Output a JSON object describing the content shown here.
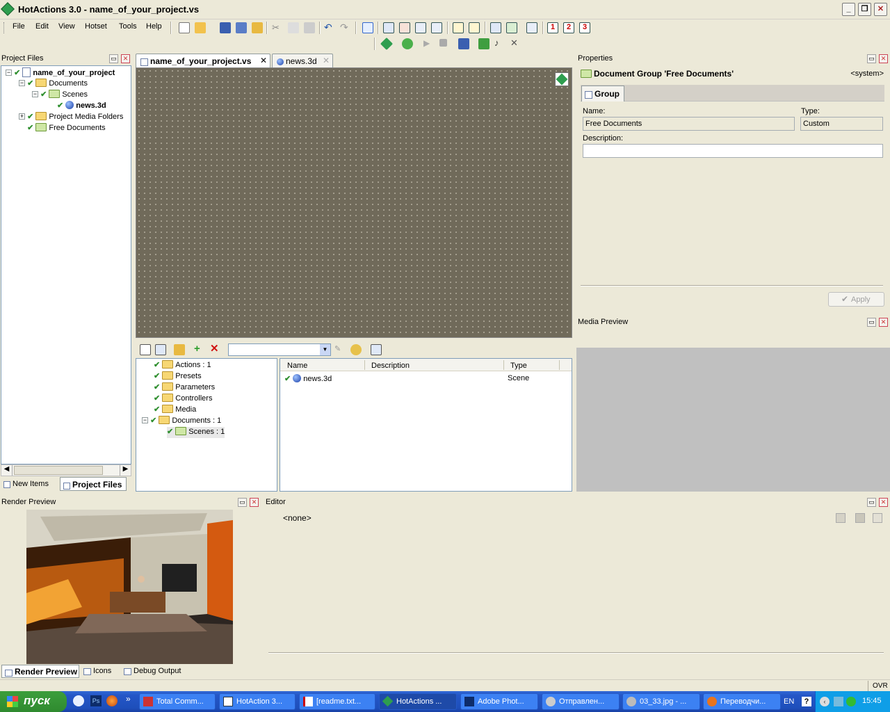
{
  "window": {
    "title": "HotActions 3.0 - name_of_your_project.vs"
  },
  "menu": [
    "File",
    "Edit",
    "View",
    "Hotset",
    "Tools",
    "Help"
  ],
  "project_files": {
    "title": "Project Files",
    "tree": [
      {
        "label": "name_of_your_project",
        "bold": true
      },
      {
        "label": "Documents"
      },
      {
        "label": "Scenes"
      },
      {
        "label": "news.3d",
        "bold": true
      },
      {
        "label": "Project Media Folders"
      },
      {
        "label": "Free Documents"
      }
    ],
    "bottom_tabs": [
      "New Items",
      "Project Files"
    ]
  },
  "doc_tabs": [
    "name_of_your_project.vs",
    "news.3d"
  ],
  "lower_tree": [
    "Actions : 1",
    "Presets",
    "Parameters",
    "Controllers",
    "Media",
    "Documents : 1",
    "Scenes : 1"
  ],
  "list": {
    "columns": [
      "Name",
      "Description",
      "Type"
    ],
    "rows": [
      {
        "name": "news.3d",
        "description": "",
        "type": "Scene"
      }
    ]
  },
  "properties": {
    "title": "Properties",
    "group_header": "Document Group 'Free Documents'",
    "system": "<system>",
    "tab": "Group",
    "name_label": "Name:",
    "name_value": "Free Documents",
    "type_label": "Type:",
    "type_value": "Custom",
    "desc_label": "Description:",
    "desc_value": "",
    "apply": "Apply"
  },
  "media_preview": {
    "title": "Media Preview"
  },
  "render_preview": {
    "title": "Render Preview",
    "tabs": [
      "Render Preview",
      "Icons",
      "Debug Output"
    ]
  },
  "editor": {
    "title": "Editor",
    "value": "<none>"
  },
  "statusbar": {
    "ovr": "OVR"
  },
  "taskbar": {
    "start": "пуск",
    "tasks": [
      "Total Comm...",
      "HotAction 3...",
      "[readme.txt...",
      "HotActions ...",
      "Adobe Phot...",
      "Отправлен...",
      "03_33.jpg - ...",
      "Переводчи..."
    ],
    "lang": "EN",
    "clock": "15:45"
  }
}
